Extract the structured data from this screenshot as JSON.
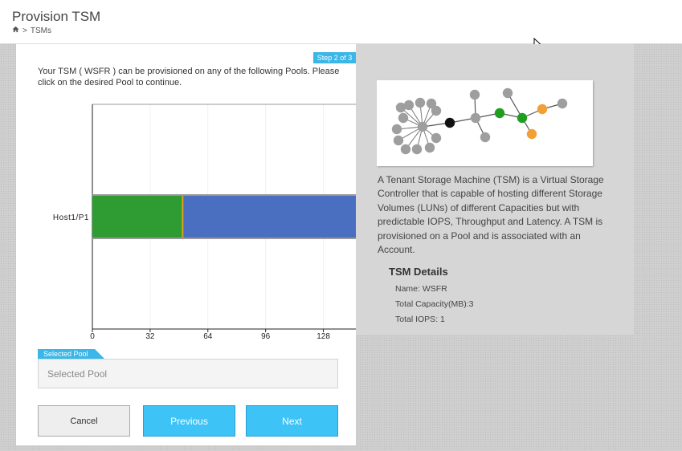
{
  "header": {
    "title": "Provision TSM",
    "breadcrumb": {
      "separator": ">",
      "current": "TSMs"
    }
  },
  "wizard": {
    "step_label": "Step 2 of 3",
    "intro_text": "Your TSM ( WSFR ) can be provisioned on any of the following Pools. Please click on the desired Pool to continue.",
    "chart_data": {
      "type": "bar",
      "orientation": "horizontal",
      "stacked": true,
      "categories": [
        "Host1/P1"
      ],
      "series": [
        {
          "color": "#2e9b33",
          "values": [
            50
          ]
        },
        {
          "color": "#4a6fc0",
          "values": [
            100
          ]
        }
      ],
      "x_ticks": [
        0,
        32,
        64,
        96,
        128
      ],
      "xlim": [
        0,
        146
      ],
      "xlabel": "",
      "ylabel": "",
      "grid": true
    },
    "selected_pool": {
      "label": "Selected Pool",
      "placeholder": "Selected Pool",
      "value": ""
    },
    "buttons": {
      "cancel": "Cancel",
      "previous": "Previous",
      "next": "Next"
    }
  },
  "info": {
    "description": "A Tenant Storage Machine (TSM) is a Virtual Storage Controller that is capable of hosting different Storage Volumes (LUNs) of different Capacities but with predictable IOPS, Throughput and Latency. A TSM is provisioned on a Pool and is associated with an Account.",
    "details_title": "TSM Details",
    "details": {
      "name": "Name: WSFR",
      "capacity": "Total Capacity(MB):3",
      "iops": "Total IOPS: 1"
    }
  },
  "colors": {
    "accent": "#3ec3f7",
    "badge": "#3ab6e8",
    "diagram_gray": "#9e9e9e",
    "diagram_green": "#1f9e1f",
    "diagram_orange": "#f0a035",
    "diagram_black": "#111111"
  },
  "icons": {
    "home": "home-icon",
    "cursor": "mouse-pointer-icon",
    "diagram": "network-graph-illustration"
  }
}
